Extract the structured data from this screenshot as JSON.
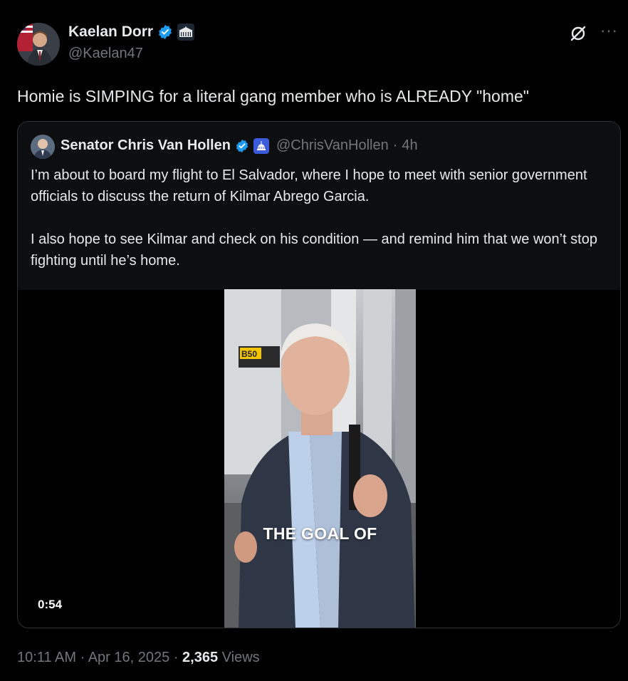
{
  "author": {
    "name": "Kaelan Dorr",
    "handle": "@Kaelan47"
  },
  "tweet": {
    "text": "Homie is SIMPING for a literal gang member who is ALREADY \"home\""
  },
  "quoted_tweet": {
    "name": "Senator Chris Van Hollen",
    "handle": "@ChrisVanHollen",
    "separator": "·",
    "age": "4h",
    "paragraph1": "I’m about to board my flight to El Salvador, where I hope to meet with senior government officials to discuss the return of Kilmar Abrego Garcia.",
    "paragraph2": "I also hope to see Kilmar and check on his condition — and remind him that we won’t stop fighting until he’s home.",
    "video": {
      "caption": "THE GOAL OF",
      "duration": "0:54",
      "gate_sign": "B50"
    }
  },
  "footer": {
    "time": "10:11 AM",
    "separator": "·",
    "date": "Apr 16, 2025",
    "views_count": "2,365",
    "views_label": "Views"
  },
  "icons": {
    "verified": "verified-badge-icon",
    "government": "white-house-icon",
    "capitol": "capitol-icon",
    "grok": "grok-icon",
    "more": "more-icon"
  },
  "colors": {
    "background": "#000000",
    "text": "#e7e9ea",
    "secondary": "#71767b",
    "verified": "#1d9bf0",
    "border": "#2f3336"
  }
}
